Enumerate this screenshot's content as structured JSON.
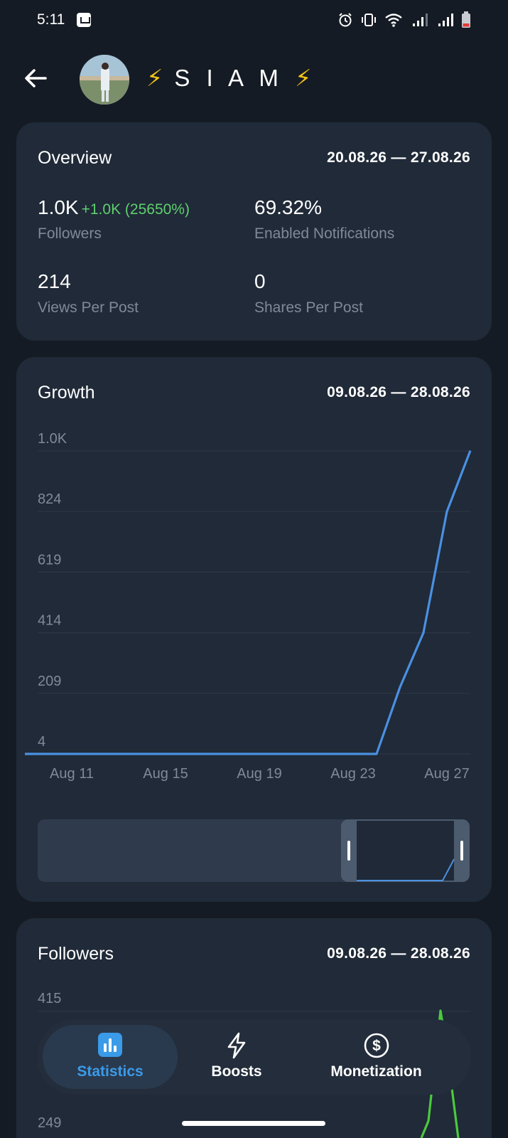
{
  "status_bar": {
    "time": "5:11",
    "icons": [
      "notification-icon",
      "alarm-icon",
      "vibrate-icon",
      "wifi-icon",
      "signal-icon",
      "signal-icon",
      "battery-low-icon"
    ]
  },
  "header": {
    "channel_name": "S I A M",
    "title_emoji_left": "⚡",
    "title_emoji_right": "⚡"
  },
  "overview": {
    "title": "Overview",
    "range": "20.08.26 — 27.08.26",
    "followers_value": "1.0K",
    "followers_delta": "+1.0K (25650%)",
    "followers_label": "Followers",
    "notifications_value": "69.32%",
    "notifications_label": "Enabled Notifications",
    "views_value": "214",
    "views_label": "Views Per Post",
    "shares_value": "0",
    "shares_label": "Shares Per Post"
  },
  "growth": {
    "title": "Growth",
    "range": "09.08.26 — 28.08.26",
    "y_ticks": [
      "1.0K",
      "824",
      "619",
      "414",
      "209",
      "4"
    ],
    "x_ticks": [
      "Aug 11",
      "Aug 15",
      "Aug 19",
      "Aug 23",
      "Aug 27"
    ]
  },
  "followers_card": {
    "title": "Followers",
    "range": "09.08.26 — 28.08.26",
    "y_ticks": [
      "415",
      "249"
    ]
  },
  "navbar": {
    "statistics": "Statistics",
    "boosts": "Boosts",
    "monetization": "Monetization"
  },
  "colors": {
    "background": "#151b24",
    "card": "#202a38",
    "growth_line": "#4a90e2",
    "followers_line": "#4bc93d",
    "delta_green": "#5fcf6e",
    "active_blue": "#3a9be9"
  },
  "chart_data": [
    {
      "type": "line",
      "title": "Growth",
      "x": [
        "Aug 9",
        "Aug 10",
        "Aug 11",
        "Aug 12",
        "Aug 13",
        "Aug 14",
        "Aug 15",
        "Aug 16",
        "Aug 17",
        "Aug 18",
        "Aug 19",
        "Aug 20",
        "Aug 21",
        "Aug 22",
        "Aug 23",
        "Aug 24",
        "Aug 25",
        "Aug 26",
        "Aug 27",
        "Aug 28"
      ],
      "series": [
        {
          "values": [
            4,
            4,
            4,
            4,
            4,
            4,
            4,
            4,
            4,
            4,
            4,
            4,
            4,
            4,
            4,
            4,
            230,
            414,
            824,
            1030
          ]
        }
      ],
      "yticks": [
        4,
        209,
        414,
        619,
        824,
        1029
      ],
      "ylim": [
        4,
        1029
      ],
      "xticks": [
        "Aug 11",
        "Aug 15",
        "Aug 19",
        "Aug 23",
        "Aug 27"
      ],
      "grid": true,
      "color": "#4a90e2"
    },
    {
      "type": "line",
      "title": "Followers",
      "yticks": [
        249,
        415
      ],
      "series": [
        {
          "values": [
            0,
            0,
            0,
            0,
            0,
            0,
            0,
            0,
            0,
            0,
            0,
            0,
            0,
            0,
            0,
            0,
            0,
            249,
            415,
            249
          ]
        }
      ],
      "color": "#4bc93d"
    }
  ]
}
